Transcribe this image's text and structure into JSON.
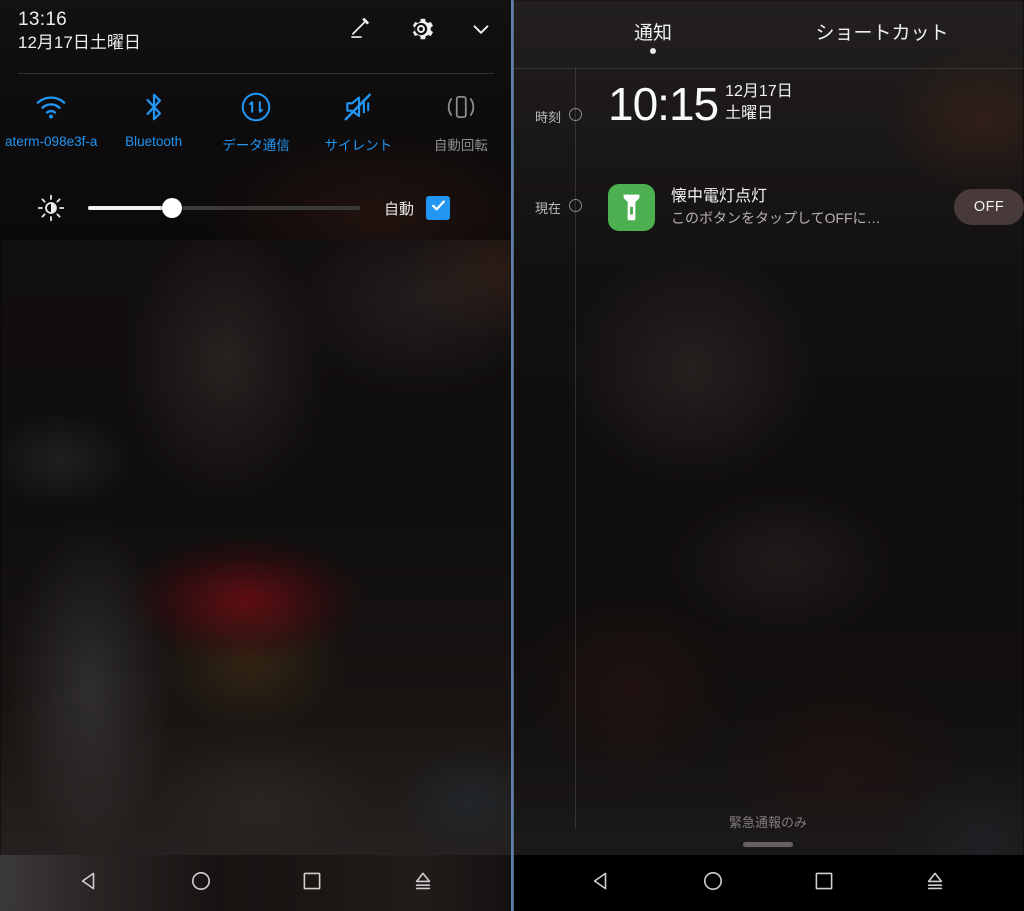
{
  "left_panel": {
    "status": {
      "time": "13:16",
      "date": "12月17日土曜日"
    },
    "actions": [
      {
        "name": "edit-icon",
        "label": "編集"
      },
      {
        "name": "gear-icon",
        "label": "設定"
      },
      {
        "name": "chevron-down-icon",
        "label": "閉じる"
      }
    ],
    "tiles": [
      {
        "icon": "wifi-icon",
        "label": "aterm-098e3f-a",
        "state": "on",
        "color": "#2196f3"
      },
      {
        "icon": "bluetooth-icon",
        "label": "Bluetooth",
        "state": "on",
        "color": "#2196f3"
      },
      {
        "icon": "data-transfer-icon",
        "label": "データ通信",
        "state": "on",
        "color": "#2196f3"
      },
      {
        "icon": "sound-mute-icon",
        "label": "サイレント",
        "state": "on",
        "color": "#2196f3"
      },
      {
        "icon": "auto-rotate-icon",
        "label": "自動回転",
        "state": "off",
        "color": "#8d8d8d"
      }
    ],
    "brightness": {
      "icon": "brightness-icon",
      "value_percent": 31,
      "auto_label": "自動",
      "auto_checked": true,
      "accent": "#2196f3"
    }
  },
  "right_panel": {
    "tabs": [
      {
        "label": "通知",
        "active": true
      },
      {
        "label": "ショートカット",
        "active": false
      }
    ],
    "timeline": [
      {
        "label": "時刻"
      },
      {
        "label": "現在"
      }
    ],
    "clock": {
      "time": "10:15",
      "date": "12月17日",
      "weekday": "土曜日"
    },
    "notification": {
      "app_icon": "flashlight-icon",
      "icon_color": "#4caf50",
      "title": "懐中電灯点灯",
      "body": "このボタンをタップしてOFFに…",
      "button_label": "OFF"
    },
    "footer_status": "緊急通報のみ",
    "drag_handle": "drag-handle"
  },
  "navbar": {
    "buttons": [
      {
        "icon": "back-triangle-icon",
        "label": "戻る"
      },
      {
        "icon": "home-circle-icon",
        "label": "ホーム"
      },
      {
        "icon": "recents-square-icon",
        "label": "履歴"
      },
      {
        "icon": "eject-up-icon",
        "label": "表示切替"
      }
    ]
  }
}
